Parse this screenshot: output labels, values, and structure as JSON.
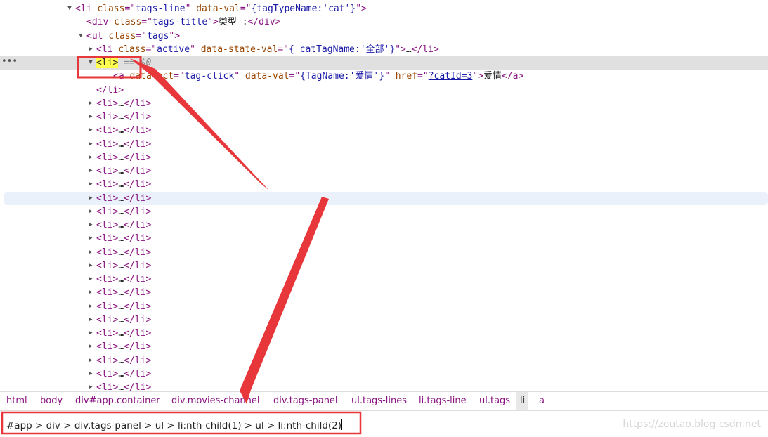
{
  "tree": [
    {
      "id": "tags-line",
      "expanded": true,
      "parts": [
        [
          "tag",
          "<li "
        ],
        [
          "an",
          "class"
        ],
        [
          "tag",
          "=\""
        ],
        [
          "av",
          "tags-line"
        ],
        [
          "tag",
          "\" "
        ],
        [
          "an",
          "data-val"
        ],
        [
          "tag",
          "=\""
        ],
        [
          "av",
          "{tagTypeName:'cat'}"
        ],
        [
          "tag",
          "\">"
        ]
      ]
    },
    {
      "id": "tags-title",
      "parts": [
        [
          "tag",
          "<div "
        ],
        [
          "an",
          "class"
        ],
        [
          "tag",
          "=\""
        ],
        [
          "av",
          "tags-title"
        ],
        [
          "tag",
          "\">"
        ],
        [
          "txt",
          "类型 :"
        ],
        [
          "tag",
          "</div>"
        ]
      ]
    },
    {
      "id": "ul-tags",
      "expanded": true,
      "parts": [
        [
          "tag",
          "<ul "
        ],
        [
          "an",
          "class"
        ],
        [
          "tag",
          "=\""
        ],
        [
          "av",
          "tags"
        ],
        [
          "tag",
          "\">"
        ]
      ]
    },
    {
      "id": "li-active",
      "expanded": false,
      "parts": [
        [
          "tag",
          "<li "
        ],
        [
          "an",
          "class"
        ],
        [
          "tag",
          "=\""
        ],
        [
          "av",
          "active"
        ],
        [
          "tag",
          "\" "
        ],
        [
          "an",
          "data-state-val"
        ],
        [
          "tag",
          "=\""
        ],
        [
          "av",
          "{ catTagName:'全部'}"
        ],
        [
          "tag",
          "\">"
        ],
        [
          "ell",
          "…"
        ],
        [
          "tag",
          "</li>"
        ]
      ]
    },
    {
      "id": "li-selected",
      "expanded": true,
      "selected": true,
      "parts": [
        [
          "hl",
          "<li>"
        ],
        [
          "ref",
          " == $0"
        ]
      ]
    },
    {
      "id": "a-tag",
      "parts": [
        [
          "tag",
          "<a "
        ],
        [
          "an",
          "data-act"
        ],
        [
          "tag",
          "=\""
        ],
        [
          "av",
          "tag-click"
        ],
        [
          "tag",
          "\" "
        ],
        [
          "an",
          "data-val"
        ],
        [
          "tag",
          "=\""
        ],
        [
          "av",
          "{TagName:'爱情'}"
        ],
        [
          "tag",
          "\" "
        ],
        [
          "an",
          "href"
        ],
        [
          "tag",
          "=\""
        ],
        [
          "link",
          "?catId=3"
        ],
        [
          "tag",
          "\">"
        ],
        [
          "txt",
          "爱情"
        ],
        [
          "tag",
          "</a>"
        ]
      ]
    },
    {
      "id": "li-close",
      "parts": [
        [
          "tag",
          "</li>"
        ]
      ]
    },
    {
      "id": "li-c1",
      "collapsed": true,
      "parts": [
        [
          "tag",
          "<li>"
        ],
        [
          "ell",
          "…"
        ],
        [
          "tag",
          "</li>"
        ]
      ]
    },
    {
      "id": "li-c2",
      "collapsed": true,
      "parts": [
        [
          "tag",
          "<li>"
        ],
        [
          "ell",
          "…"
        ],
        [
          "tag",
          "</li>"
        ]
      ]
    },
    {
      "id": "li-c3",
      "collapsed": true,
      "parts": [
        [
          "tag",
          "<li>"
        ],
        [
          "ell",
          "…"
        ],
        [
          "tag",
          "</li>"
        ]
      ]
    },
    {
      "id": "li-c4",
      "collapsed": true,
      "parts": [
        [
          "tag",
          "<li>"
        ],
        [
          "ell",
          "…"
        ],
        [
          "tag",
          "</li>"
        ]
      ]
    },
    {
      "id": "li-c5",
      "collapsed": true,
      "parts": [
        [
          "tag",
          "<li>"
        ],
        [
          "ell",
          "…"
        ],
        [
          "tag",
          "</li>"
        ]
      ]
    },
    {
      "id": "li-c6",
      "collapsed": true,
      "parts": [
        [
          "tag",
          "<li>"
        ],
        [
          "ell",
          "…"
        ],
        [
          "tag",
          "</li>"
        ]
      ]
    },
    {
      "id": "li-c7",
      "collapsed": true,
      "parts": [
        [
          "tag",
          "<li>"
        ],
        [
          "ell",
          "…"
        ],
        [
          "tag",
          "</li>"
        ]
      ]
    },
    {
      "id": "li-c8",
      "collapsed": true,
      "hover": true,
      "parts": [
        [
          "tag",
          "<li>"
        ],
        [
          "ell",
          "…"
        ],
        [
          "tag",
          "</li>"
        ]
      ]
    },
    {
      "id": "li-c9",
      "collapsed": true,
      "parts": [
        [
          "tag",
          "<li>"
        ],
        [
          "ell",
          "…"
        ],
        [
          "tag",
          "</li>"
        ]
      ]
    },
    {
      "id": "li-c10",
      "collapsed": true,
      "parts": [
        [
          "tag",
          "<li>"
        ],
        [
          "ell",
          "…"
        ],
        [
          "tag",
          "</li>"
        ]
      ]
    },
    {
      "id": "li-c11",
      "collapsed": true,
      "parts": [
        [
          "tag",
          "<li>"
        ],
        [
          "ell",
          "…"
        ],
        [
          "tag",
          "</li>"
        ]
      ]
    },
    {
      "id": "li-c12",
      "collapsed": true,
      "parts": [
        [
          "tag",
          "<li>"
        ],
        [
          "ell",
          "…"
        ],
        [
          "tag",
          "</li>"
        ]
      ]
    },
    {
      "id": "li-c13",
      "collapsed": true,
      "parts": [
        [
          "tag",
          "<li>"
        ],
        [
          "ell",
          "…"
        ],
        [
          "tag",
          "</li>"
        ]
      ]
    },
    {
      "id": "li-c14",
      "collapsed": true,
      "parts": [
        [
          "tag",
          "<li>"
        ],
        [
          "ell",
          "…"
        ],
        [
          "tag",
          "</li>"
        ]
      ]
    },
    {
      "id": "li-c15",
      "collapsed": true,
      "parts": [
        [
          "tag",
          "<li>"
        ],
        [
          "ell",
          "…"
        ],
        [
          "tag",
          "</li>"
        ]
      ]
    },
    {
      "id": "li-c16",
      "collapsed": true,
      "parts": [
        [
          "tag",
          "<li>"
        ],
        [
          "ell",
          "…"
        ],
        [
          "tag",
          "</li>"
        ]
      ]
    },
    {
      "id": "li-c17",
      "collapsed": true,
      "parts": [
        [
          "tag",
          "<li>"
        ],
        [
          "ell",
          "…"
        ],
        [
          "tag",
          "</li>"
        ]
      ]
    },
    {
      "id": "li-c18",
      "collapsed": true,
      "parts": [
        [
          "tag",
          "<li>"
        ],
        [
          "ell",
          "…"
        ],
        [
          "tag",
          "</li>"
        ]
      ]
    },
    {
      "id": "li-c19",
      "collapsed": true,
      "parts": [
        [
          "tag",
          "<li>"
        ],
        [
          "ell",
          "…"
        ],
        [
          "tag",
          "</li>"
        ]
      ]
    },
    {
      "id": "li-c20",
      "collapsed": true,
      "parts": [
        [
          "tag",
          "<li>"
        ],
        [
          "ell",
          "…"
        ],
        [
          "tag",
          "</li>"
        ]
      ]
    },
    {
      "id": "li-c21",
      "collapsed": true,
      "parts": [
        [
          "tag",
          "<li>"
        ],
        [
          "ell",
          "…"
        ],
        [
          "tag",
          "</li>"
        ]
      ]
    },
    {
      "id": "li-c22",
      "collapsed": true,
      "parts": [
        [
          "tag",
          "<li>"
        ],
        [
          "ell",
          "…"
        ],
        [
          "tag",
          "</li>"
        ]
      ]
    }
  ],
  "breadcrumbs": [
    {
      "tag": "html",
      "cls": ""
    },
    {
      "tag": "body",
      "cls": ""
    },
    {
      "tag": "div",
      "cls": "#app.container"
    },
    {
      "tag": "div",
      "cls": ".movies-channel"
    },
    {
      "tag": "div",
      "cls": ".tags-panel"
    },
    {
      "tag": "ul",
      "cls": ".tags-lines"
    },
    {
      "tag": "li",
      "cls": ".tags-line"
    },
    {
      "tag": "ul",
      "cls": ".tags"
    },
    {
      "tag": "li",
      "cls": "",
      "active": true
    },
    {
      "tag": "a",
      "cls": ""
    }
  ],
  "selector": {
    "value": "#app > div > div.tags-panel > ul > li:nth-child(1) > ul > li:nth-child(2)"
  },
  "watermark": "https://zoutao.blog.csdn.net",
  "sidebar_dots": "•••",
  "colors": {
    "tag": "#881280",
    "attr_name": "#994500",
    "attr_value": "#1a1aa6",
    "annotation": "#e8373a",
    "highlight": "#ffff4d"
  }
}
